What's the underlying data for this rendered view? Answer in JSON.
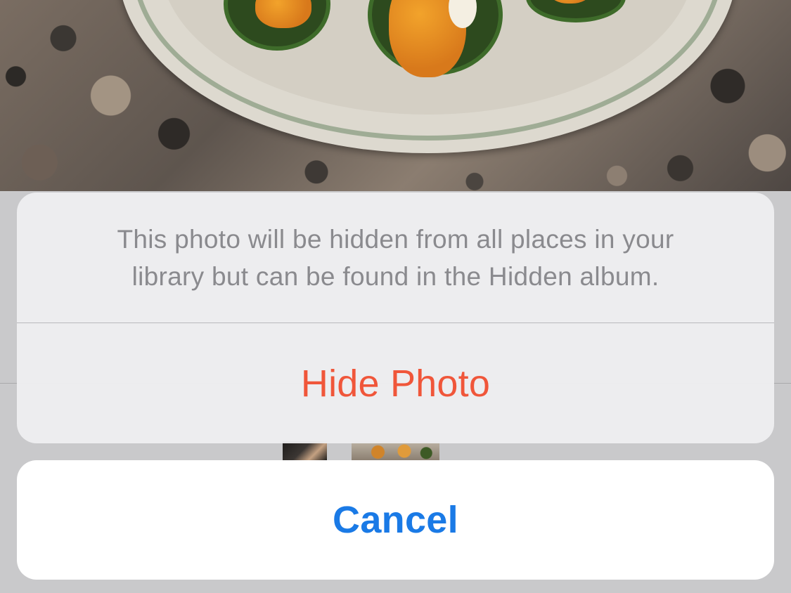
{
  "action_sheet": {
    "message": "This photo will be hidden from all places in your library but can be found in the Hidden album.",
    "destructive_action_label": "Hide Photo",
    "cancel_label": "Cancel"
  },
  "colors": {
    "destructive": "#f0563a",
    "cancel": "#1a7ae6",
    "message_text": "#8a8a8e",
    "sheet_background": "#eeeef0"
  }
}
